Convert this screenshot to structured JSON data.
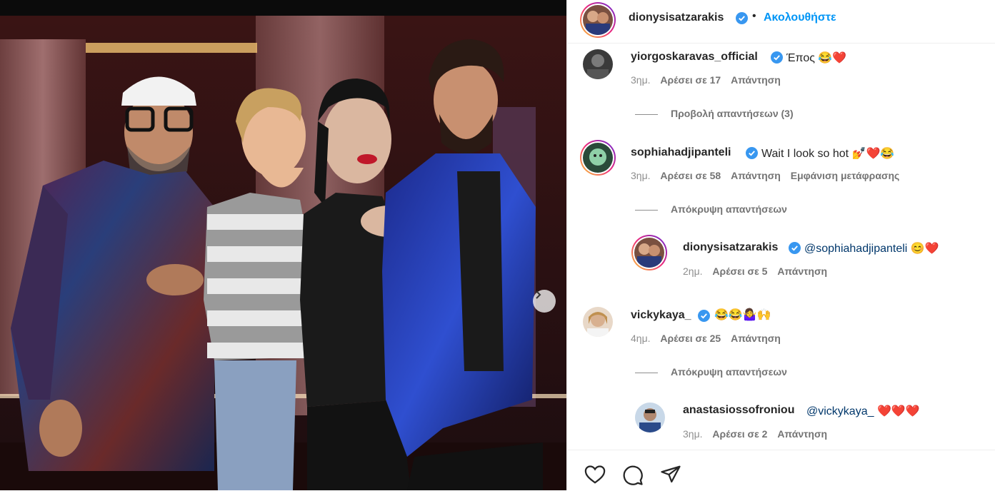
{
  "header": {
    "username": "dionysisatzarakis",
    "separator": "•",
    "follow_label": "Ακολουθήστε"
  },
  "comments": [
    {
      "username": "yiorgoskaravas_official",
      "text": "Έπος 😂❤️",
      "time": "3ημ.",
      "likes": "Αρέσει σε 17",
      "reply": "Απάντηση",
      "toggle": "Προβολή απαντήσεων (3)"
    },
    {
      "username": "sophiahadjipanteli",
      "text": "Wait I look so hot 💅❤️😂",
      "time": "3ημ.",
      "likes": "Αρέσει σε 58",
      "reply": "Απάντηση",
      "translate": "Εμφάνιση μετάφρασης",
      "toggle": "Απόκρυψη απαντήσεων",
      "replies": [
        {
          "username": "dionysisatzarakis",
          "mention": "@sophiahadjipanteli",
          "text": " 😊❤️",
          "time": "2ημ.",
          "likes": "Αρέσει σε 5",
          "reply": "Απάντηση"
        }
      ]
    },
    {
      "username": "vickykaya_",
      "text": "😂😂🤷‍♀️🙌",
      "time": "4ημ.",
      "likes": "Αρέσει σε 25",
      "reply": "Απάντηση",
      "toggle": "Απόκρυψη απαντήσεων",
      "replies": [
        {
          "username": "anastasiossofroniou",
          "mention": "@vickykaya_",
          "text": " ❤️❤️❤️",
          "time": "3ημ.",
          "likes": "Αρέσει σε 2",
          "reply": "Απάντηση"
        }
      ]
    }
  ],
  "icons": [
    "heart-icon",
    "comment-icon",
    "share-icon",
    "verified-icon",
    "chevron-right-icon"
  ],
  "colors": {
    "link_blue": "#0095f6",
    "verified_blue": "#3897f0",
    "meta_gray": "#8e8e8e"
  }
}
